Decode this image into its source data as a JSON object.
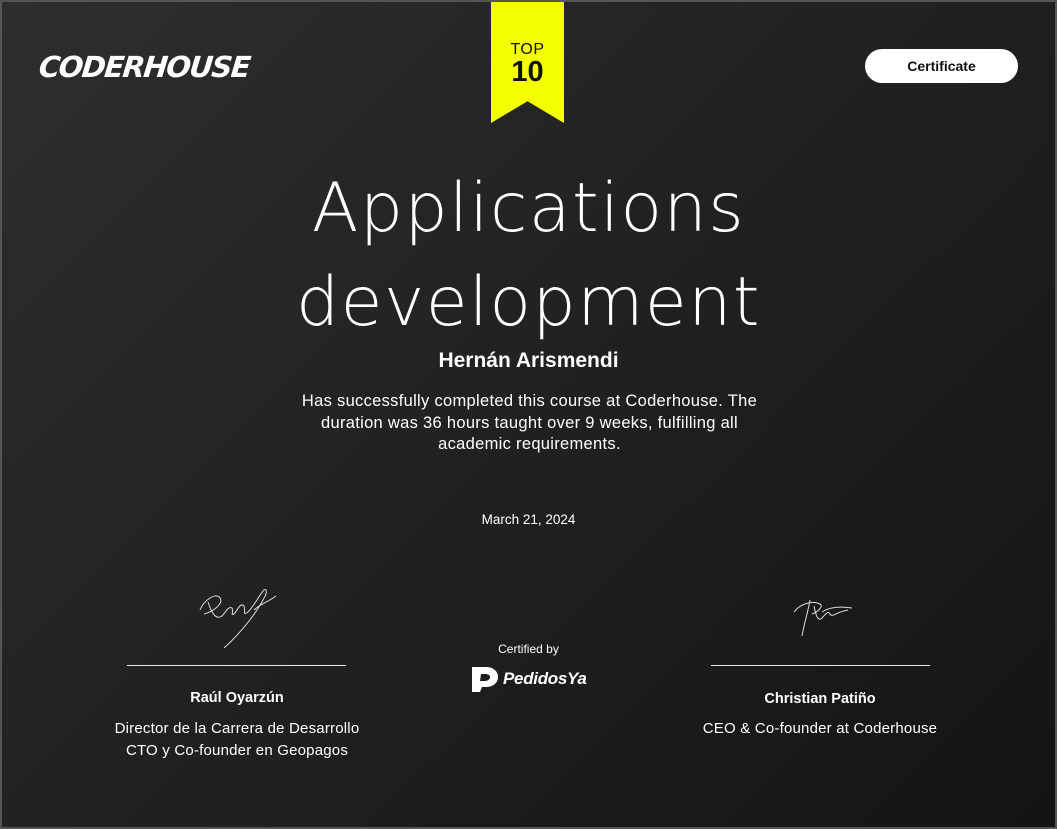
{
  "header": {
    "logo_text": "CODERHOUSE",
    "badge_top": "TOP",
    "badge_rank": "10",
    "badge_color": "#f4ff00",
    "certificate_button_label": "Certificate"
  },
  "certificate": {
    "course_title_line1": "Applications",
    "course_title_line2": "development",
    "student_name": "Hernán Arismendi",
    "description_line1": "Has successfully completed this course at Coderhouse. The",
    "description_line2": "duration was 36 hours taught over 9 weeks, fulfilling all",
    "description_line3": "academic requirements.",
    "date": "March 21, 2024"
  },
  "signers": {
    "left": {
      "name": "Raúl Oyarzún",
      "role_line1": "Director de la Carrera de Desarrollo",
      "role_line2": "CTO y Co-founder en Geopagos"
    },
    "right": {
      "name": "Christian Patiño",
      "role_line1": "CEO & Co-founder at Coderhouse"
    }
  },
  "partner": {
    "certified_by_label": "Certified by",
    "name": "PedidosYa"
  },
  "colors": {
    "background": "#222223",
    "text": "#ffffff",
    "button_bg": "#ffffff",
    "button_text": "#111111"
  }
}
